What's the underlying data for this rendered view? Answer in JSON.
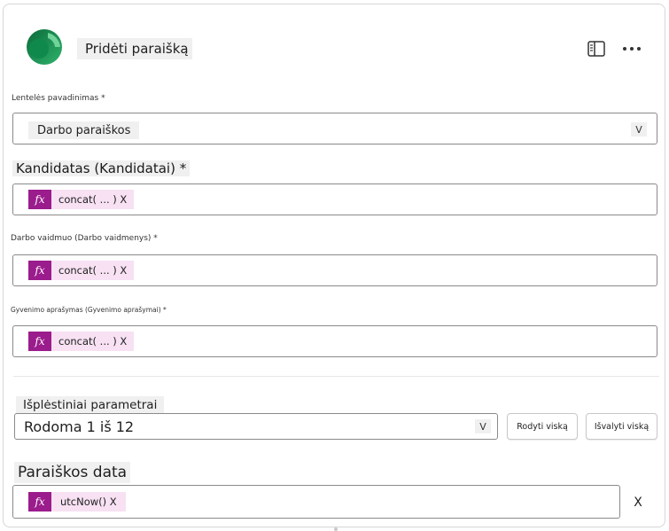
{
  "header": {
    "title": "Pridėti paraišką",
    "logo_icon": "dynamics-logo-icon",
    "panel_icon": "side-panel-icon",
    "more_icon": "more-options-icon"
  },
  "table_field": {
    "label": "Lentelės pavadinimas *",
    "value": "Darbo paraiškos",
    "chevron": "V"
  },
  "candidate_field": {
    "label": "Kandidatas (Kandidatai) *",
    "fx": "fx",
    "expression": "concat( ... ) X"
  },
  "role_field": {
    "label": "Darbo vaidmuo (Darbo vaidmenys) *",
    "fx": "fx",
    "expression": "concat( ... ) X"
  },
  "resume_field": {
    "label": "Gyvenimo aprašymas (Gyvenimo aprašymai) *",
    "fx": "fx",
    "expression": "concat( ... ) X"
  },
  "advanced": {
    "label": "Išplėstiniai parametrai",
    "counter": "Rodoma 1 iš 12",
    "chevron": "V",
    "show_all": "Rodyti viską",
    "clear_all": "Išvalyti viską"
  },
  "date_field": {
    "label": "Paraiškos data",
    "fx": "fx",
    "expression": "utcNow() X",
    "clear": "X"
  },
  "colors": {
    "fx_badge": "#9b1c8c",
    "fx_chip_bg": "#f7e1f3",
    "label_bg": "#f0f0f0"
  }
}
